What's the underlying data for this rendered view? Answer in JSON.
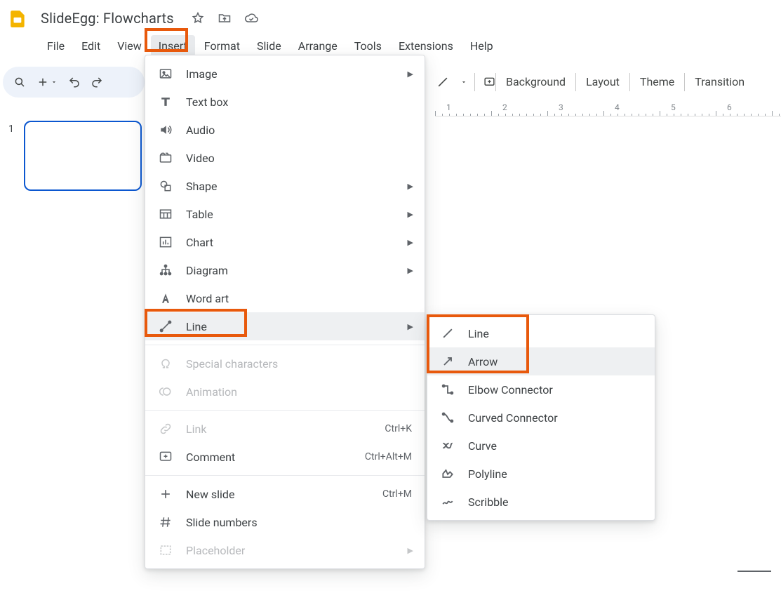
{
  "doc_title": "SlideEgg: Flowcharts",
  "menubar": [
    "File",
    "Edit",
    "View",
    "Insert",
    "Format",
    "Slide",
    "Arrange",
    "Tools",
    "Extensions",
    "Help"
  ],
  "menubar_active_index": 3,
  "toolbar_right": {
    "background": "Background",
    "layout": "Layout",
    "theme": "Theme",
    "transition": "Transition"
  },
  "slide_number": "1",
  "ruler_numbers": [
    "1",
    "2",
    "3",
    "4",
    "5",
    "6"
  ],
  "insert_menu": {
    "image": "Image",
    "textbox": "Text box",
    "audio": "Audio",
    "video": "Video",
    "shape": "Shape",
    "table": "Table",
    "chart": "Chart",
    "diagram": "Diagram",
    "wordart": "Word art",
    "line": "Line",
    "special": "Special characters",
    "animation": "Animation",
    "link": "Link",
    "link_kbd": "Ctrl+K",
    "comment": "Comment",
    "comment_kbd": "Ctrl+Alt+M",
    "newslide": "New slide",
    "newslide_kbd": "Ctrl+M",
    "slidenumbers": "Slide numbers",
    "placeholder": "Placeholder"
  },
  "line_submenu": {
    "line": "Line",
    "arrow": "Arrow",
    "elbow": "Elbow Connector",
    "curved": "Curved Connector",
    "curve": "Curve",
    "polyline": "Polyline",
    "scribble": "Scribble"
  }
}
